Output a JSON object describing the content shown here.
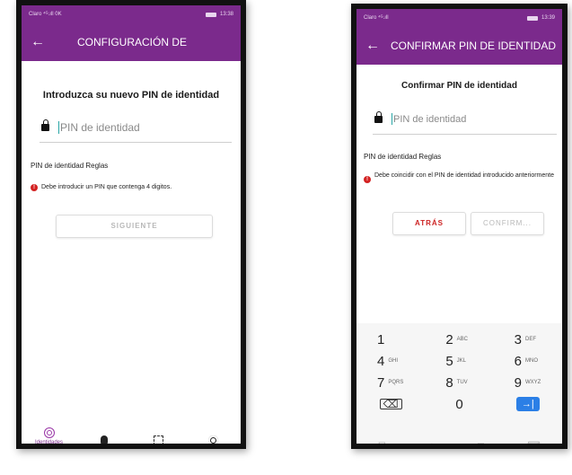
{
  "left_screen": {
    "status_bar": {
      "carrier": "Claro ⁴ᴳ.ıll 0K",
      "time": "13:38"
    },
    "app_bar": {
      "back_glyph": "←",
      "title": "CONFIGURACIÓN DE"
    },
    "heading": "Introduzca su nuevo PIN de identidad",
    "pin_field": {
      "placeholder": "PIN de identidad"
    },
    "rules_title": "PIN de identidad Reglas",
    "rules": [
      {
        "icon": "error-icon",
        "text": "Debe introducir un PIN que contenga 4 digitos."
      }
    ],
    "next_button": "SIGUIENTE",
    "bottom_nav": [
      {
        "icon": "fingerprint-icon",
        "label": "Identidades"
      },
      {
        "icon": "bell-icon",
        "label": ""
      },
      {
        "icon": "qr-scan-icon",
        "label": ""
      },
      {
        "icon": "gear-icon",
        "label": ""
      }
    ]
  },
  "right_screen": {
    "status_bar": {
      "carrier": "Claro ⁴ᴳ.ıll",
      "time": "13:39"
    },
    "app_bar": {
      "back_glyph": "←",
      "title": "CONFIRMAR PIN DE IDENTIDAD"
    },
    "heading": "Confirmar PIN de identidad",
    "pin_field": {
      "placeholder": "PIN de identidad"
    },
    "rules_title": "PIN de identidad Reglas",
    "rules": [
      {
        "icon": "error-icon",
        "text": "Debe coincidir con el PIN de identidad introducido anteriormente"
      }
    ],
    "back_button": "ATRÁS",
    "confirm_button": "CONFIRM...",
    "keypad": {
      "keys": [
        {
          "digit": "1",
          "letters": ""
        },
        {
          "digit": "2",
          "letters": "ABC"
        },
        {
          "digit": "3",
          "letters": "DEF"
        },
        {
          "digit": "4",
          "letters": "GHI"
        },
        {
          "digit": "5",
          "letters": "JKL"
        },
        {
          "digit": "6",
          "letters": "MNO"
        },
        {
          "digit": "7",
          "letters": "PQRS"
        },
        {
          "digit": "8",
          "letters": "TUV"
        },
        {
          "digit": "9",
          "letters": "WXYZ"
        }
      ],
      "zero": "0",
      "backspace_glyph": "⌫",
      "go_glyph": "→|"
    },
    "system_nav": {
      "back": "▽",
      "home": "○",
      "recents": "□",
      "keyboard": "⌨"
    }
  },
  "colors": {
    "accent": "#7b2a8c",
    "error": "#d32222",
    "key_go": "#2b7fe6"
  }
}
